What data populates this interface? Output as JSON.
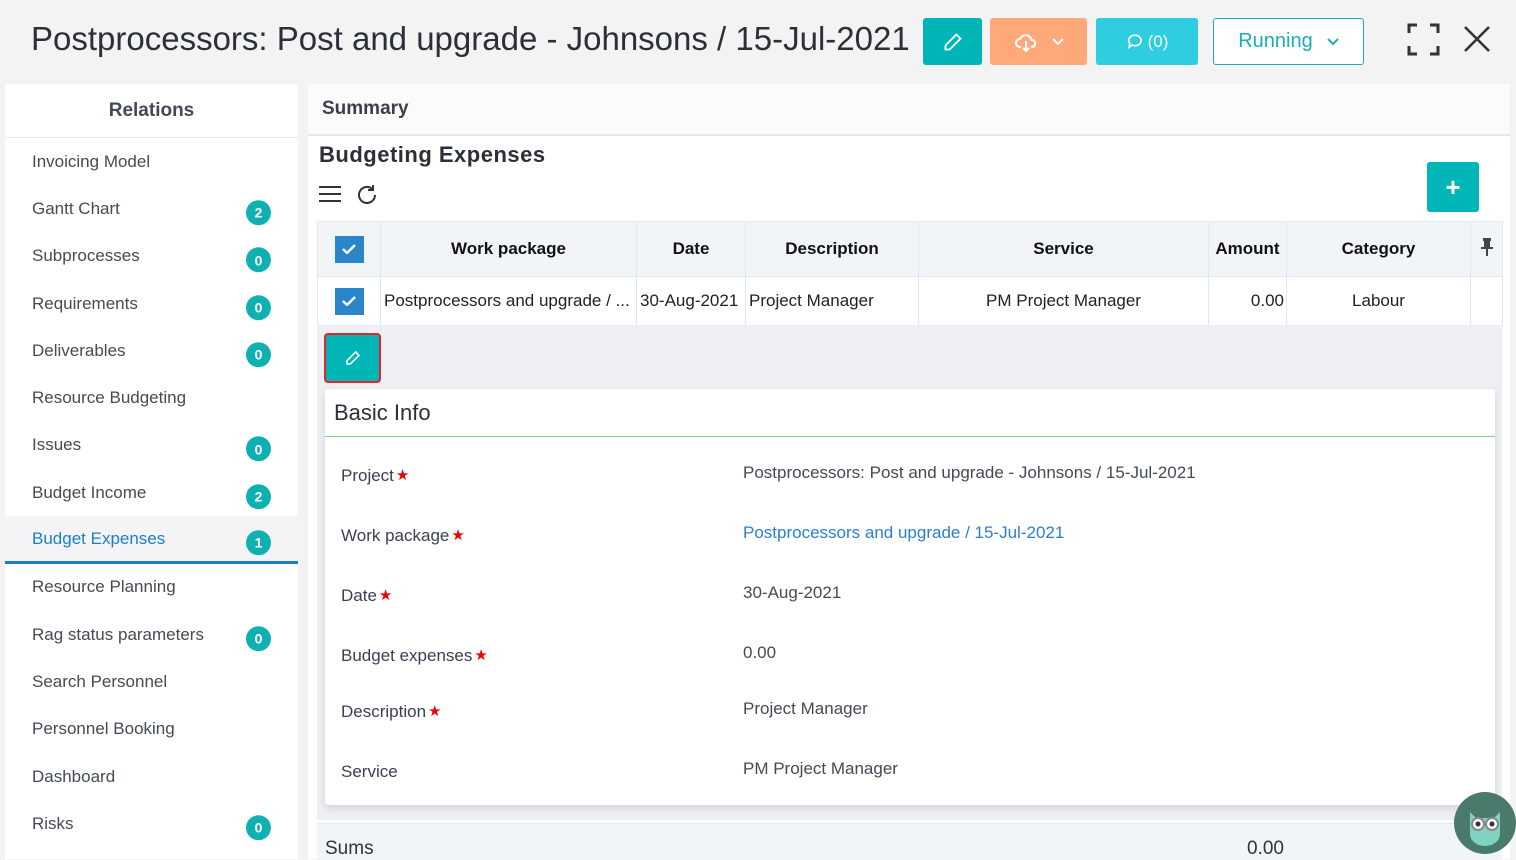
{
  "header": {
    "title": "Postprocessors: Post and upgrade - Johnsons / 15-Jul-2021",
    "comment_label": "(0)",
    "status": "Running"
  },
  "sidebar": {
    "title": "Relations",
    "items": [
      {
        "label": "Invoicing Model",
        "badge": null
      },
      {
        "label": "Gantt Chart",
        "badge": "2"
      },
      {
        "label": "Subprocesses",
        "badge": "0"
      },
      {
        "label": "Requirements",
        "badge": "0"
      },
      {
        "label": "Deliverables",
        "badge": "0"
      },
      {
        "label": "Resource Budgeting",
        "badge": null
      },
      {
        "label": "Issues",
        "badge": "0"
      },
      {
        "label": "Budget Income",
        "badge": "2"
      },
      {
        "label": "Budget Expenses",
        "badge": "1",
        "active": true
      },
      {
        "label": "Resource Planning",
        "badge": null
      },
      {
        "label": "Rag status parameters",
        "badge": "0"
      },
      {
        "label": "Search Personnel",
        "badge": null
      },
      {
        "label": "Personnel Booking",
        "badge": null
      },
      {
        "label": "Dashboard",
        "badge": null
      },
      {
        "label": "Risks",
        "badge": "0"
      }
    ]
  },
  "main": {
    "summary_tab": "Summary",
    "section_title": "Budgeting Expenses",
    "table": {
      "columns": [
        "Work package",
        "Date",
        "Description",
        "Service",
        "Amount",
        "Category"
      ],
      "rows": [
        {
          "work_package": "Postprocessors and upgrade / ...",
          "date": "30-Aug-2021",
          "description": "Project Manager",
          "service": "PM Project Manager",
          "amount": "0.00",
          "category": "Labour"
        }
      ]
    },
    "detail": {
      "title": "Basic Info",
      "fields": [
        {
          "label": "Project",
          "required": true,
          "value": "Postprocessors: Post and upgrade - Johnsons / 15-Jul-2021"
        },
        {
          "label": "Work package",
          "required": true,
          "value": "Postprocessors and upgrade / 15-Jul-2021",
          "link": true
        },
        {
          "label": "Date",
          "required": true,
          "value": "30-Aug-2021"
        },
        {
          "label": "Budget expenses",
          "required": true,
          "value": "0.00"
        },
        {
          "label": "Description",
          "required": true,
          "value": "Project Manager"
        },
        {
          "label": "Service",
          "required": false,
          "value": "PM Project Manager"
        }
      ]
    },
    "sums": {
      "label": "Sums",
      "amount": "0.00"
    }
  }
}
